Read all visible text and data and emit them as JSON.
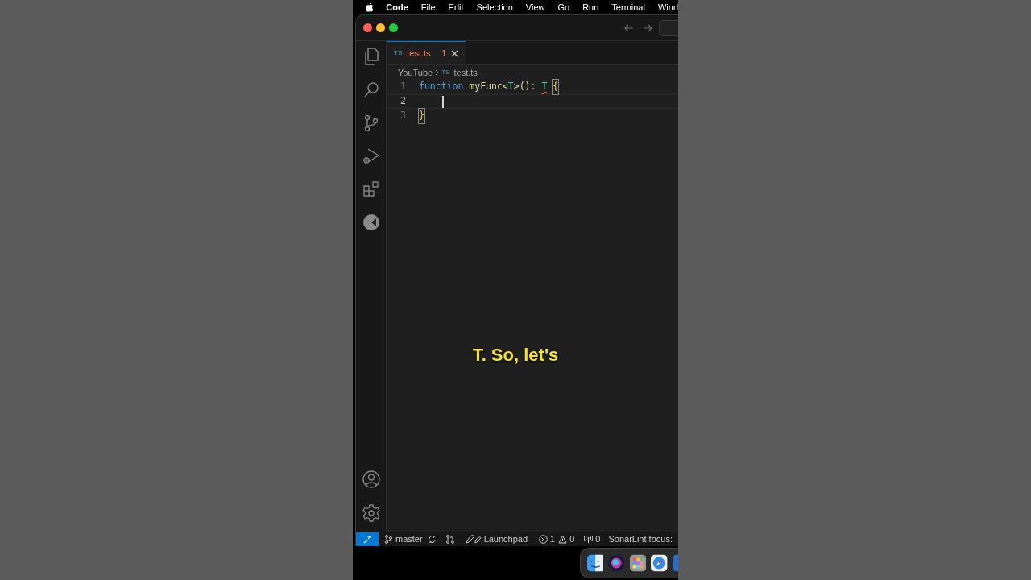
{
  "menu_bar": {
    "app": "Code",
    "items": [
      "File",
      "Edit",
      "Selection",
      "View",
      "Go",
      "Run",
      "Terminal",
      "Wind"
    ]
  },
  "tabs": [
    {
      "badge": "TS",
      "label": "test.ts",
      "problems": "1",
      "selected": true
    }
  ],
  "breadcrumb": {
    "folder": "YouTube",
    "badge": "TS",
    "file": "test.ts"
  },
  "code_lines": [
    {
      "number": "1",
      "active": false,
      "cursor": false,
      "tokens": [
        {
          "kind": "keyword",
          "text": "function "
        },
        {
          "kind": "function",
          "text": "myFunc"
        },
        {
          "kind": "function",
          "text": "<"
        },
        {
          "kind": "type",
          "text": "T"
        },
        {
          "kind": "function",
          "text": ">()"
        },
        {
          "kind": "punct",
          "text": ": "
        },
        {
          "kind": "type",
          "text": "T",
          "error": true
        },
        {
          "kind": "bracket",
          "text": "{",
          "matched": true
        }
      ]
    },
    {
      "number": "2",
      "active": true,
      "cursor": true
    },
    {
      "number": "3",
      "active": false,
      "cursor": false,
      "tokens": [
        {
          "kind": "bracket",
          "text": "}",
          "matched": true
        }
      ]
    }
  ],
  "caption": "T. So, let's",
  "status_bar": {
    "branch": "master",
    "launchpad": "Launchpad",
    "errors": "1",
    "warnings": "0",
    "ports": "0",
    "sonarlint": "SonarLint focus:"
  }
}
